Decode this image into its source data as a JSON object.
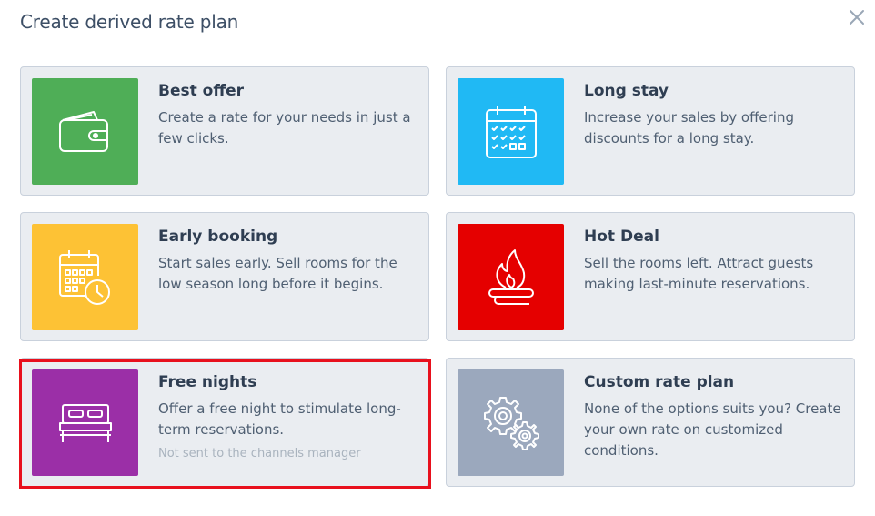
{
  "dialog": {
    "title": "Create derived rate plan"
  },
  "icons": {
    "close": "close-icon",
    "best_offer": "wallet-icon",
    "long_stay": "calendar-checks-icon",
    "early_booking": "calendar-clock-icon",
    "hot_deal": "flame-icon",
    "free_nights": "bed-icon",
    "custom": "gears-icon"
  },
  "colors": {
    "best_offer": "#4fae57",
    "long_stay": "#20b9f4",
    "early_booking": "#fdc235",
    "hot_deal": "#e50000",
    "free_nights": "#9b2fa7",
    "custom": "#9ba8bd",
    "selected_outline": "#e8101d"
  },
  "cards": [
    {
      "title": "Best offer",
      "description": "Create a rate for your needs in just a few clicks."
    },
    {
      "title": "Long stay",
      "description": "Increase your sales by offering discounts for a long stay."
    },
    {
      "title": "Early booking",
      "description": "Start sales early. Sell rooms for the low season long before it begins."
    },
    {
      "title": "Hot Deal",
      "description": "Sell the rooms left. Attract guests making last-minute reservations."
    },
    {
      "title": "Free nights",
      "description": "Offer a free night to stimulate long-term reservations.",
      "note": "Not sent to the channels manager",
      "selected": true
    },
    {
      "title": "Custom rate plan",
      "description": "None of the options suits you? Create your own rate on customized conditions."
    }
  ]
}
